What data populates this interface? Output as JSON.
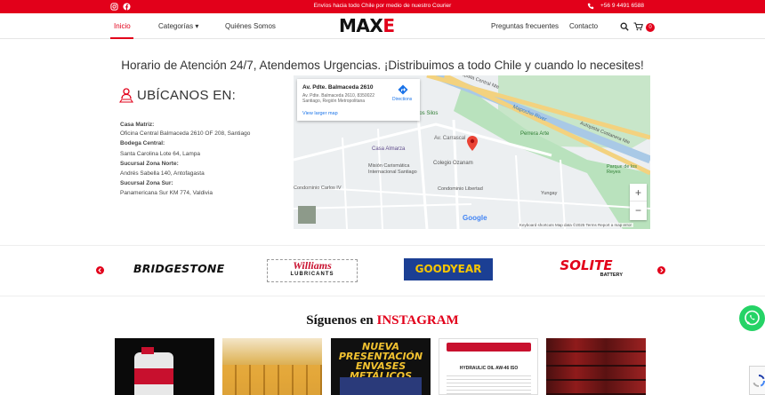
{
  "topbar": {
    "shipping_text": "Envíos hacia todo Chile por medio de nuestro Courier",
    "phone": "+56 9 4491 6588",
    "icons": [
      "instagram-icon",
      "facebook-icon",
      "phone-icon"
    ]
  },
  "nav": {
    "items": [
      {
        "label": "Inicio",
        "active": true
      },
      {
        "label": "Categorías ▾"
      },
      {
        "label": "Quiénes Somos"
      },
      {
        "label": "Preguntas frecuentes"
      },
      {
        "label": "Contacto"
      }
    ],
    "logo_main": "MAX",
    "logo_accent": "E",
    "cart_count": "0"
  },
  "headline": "Horario de Atención 24/7, Atendemos Urgencias. ¡Distribuimos a todo Chile y cuando lo necesites!",
  "locations": {
    "title": "UBÍCANOS EN:",
    "entries": [
      {
        "label": "Casa Matriz:",
        "value": "Oficina Central Balmaceda 2610 OF 208, Santiago"
      },
      {
        "label": "Bodega Central:",
        "value": "Santa Carolina Lote 64, Lampa"
      },
      {
        "label": "Sucursal Zona Norte:",
        "value": "Andrés Sabella 140, Antofagasta"
      },
      {
        "label": "Sucursal Zona Sur:",
        "value": "Panamericana Sur KM 774, Valdivia"
      }
    ]
  },
  "map": {
    "card_title": "Av. Pdte. Balmaceda 2610",
    "card_address": "Av. Pdte. Balmaceda 2610, 8350022 Santiago, Región Metropolitana",
    "directions_label": "Directions",
    "larger_map_label": "View larger map",
    "labels": [
      "Autopista Central Nte",
      "Mapocho River",
      "Autopista Costanera Nte",
      "Los Silos",
      "Perrera Arte",
      "Casa Almarza",
      "Misión Carismática Internacional Santiago",
      "Colegio Ozanam",
      "Condominio Carlos IV",
      "Condominio Libertad",
      "Parque de los Reyes",
      "Yungay",
      "Av. Carrascal",
      "TIVIT",
      "Martinez",
      "Libertad",
      "Esperanza",
      "Cueto",
      "Ricardo Cumming",
      "Av. Balmaceda",
      "Gral. Bulnes",
      "Santo Domingo",
      "Catedral",
      "Yungay",
      "Andes",
      "Carrascal"
    ],
    "google_label": "Google",
    "footer": "Keyboard shortcuts   Map data ©2025   Terms   Report a map error"
  },
  "brands": [
    "BRIDGESTONE",
    "Williams",
    "LUBRICANTS",
    "GOODYEAR",
    "SOLITE",
    "BATTERY"
  ],
  "instagram": {
    "title_prefix": "Síguenos en",
    "title_accent": "INSTAGRAM",
    "posts": [
      {
        "text": ""
      },
      {
        "text": ""
      },
      {
        "text": "NUEVA PRESENTACIÓN ENVASES METÁLICOS"
      },
      {
        "text": "HYDRAULIC OIL AW-46 ISO"
      },
      {
        "text": ""
      }
    ]
  },
  "colors": {
    "accent": "#e2001a",
    "whatsapp": "#25d366",
    "map_green": "#c8e6c9"
  }
}
